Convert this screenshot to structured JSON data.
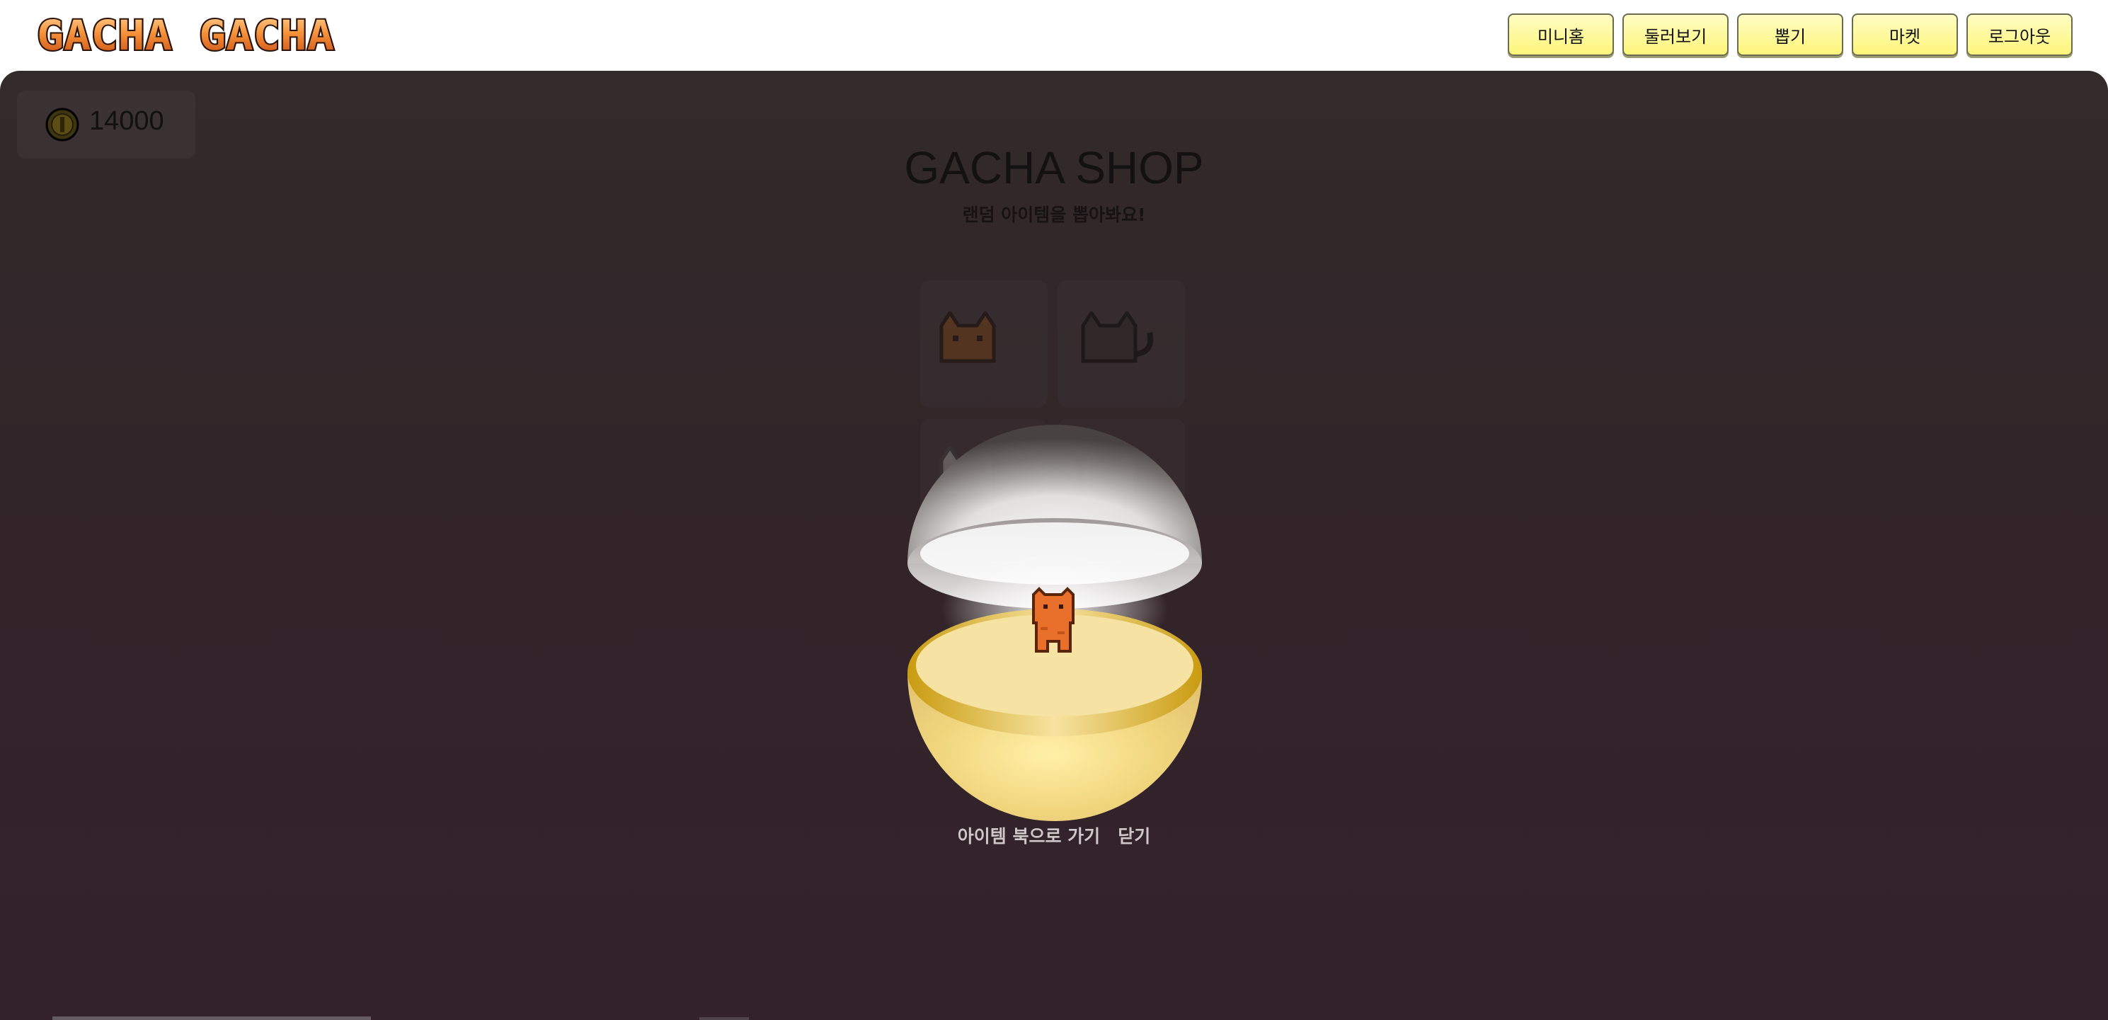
{
  "header": {
    "logo_text": "GACHA GACHA",
    "nav": [
      {
        "label": "미니홈"
      },
      {
        "label": "둘러보기"
      },
      {
        "label": "뽑기"
      },
      {
        "label": "마켓"
      },
      {
        "label": "로그아웃"
      }
    ]
  },
  "wallet": {
    "coins": "14000",
    "icon": "coin-icon"
  },
  "shop": {
    "title": "GACHA SHOP",
    "subtitle": "랜덤 아이템을 뽑아봐요!"
  },
  "result_modal": {
    "item_icon": "orange-cat-item-icon",
    "capsule_top_color": "#ffffff",
    "capsule_bottom_color": "#f2d37a",
    "go_inventory_label": "아이템 북으로 가기",
    "close_label": "닫기"
  },
  "colors": {
    "nav_button": "#fdf57a",
    "panel_bg": "#322529",
    "logo_orange": "#f07a2b"
  }
}
